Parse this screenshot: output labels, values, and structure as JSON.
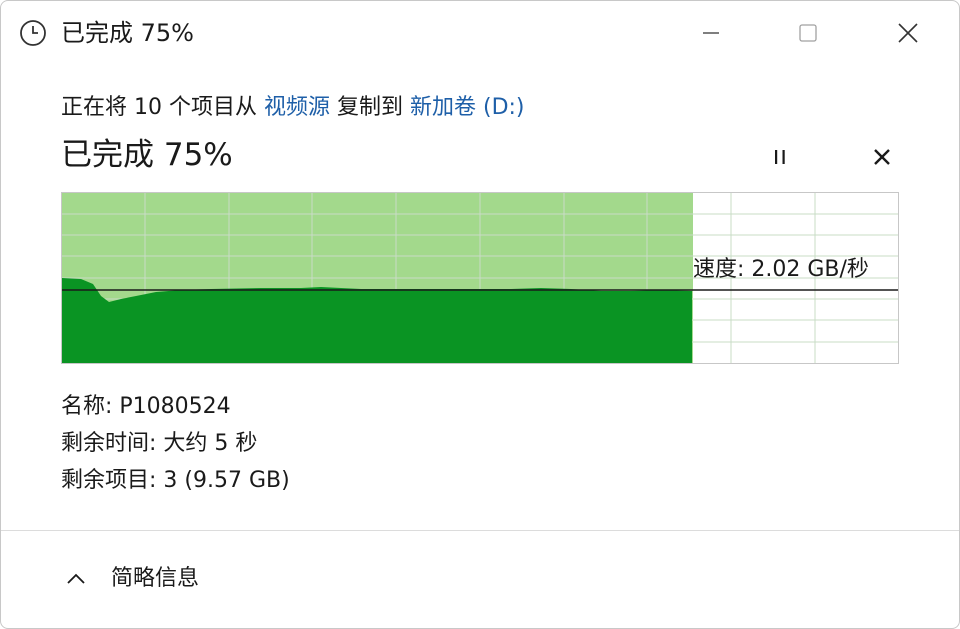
{
  "window": {
    "title": "已完成 75%",
    "minimize_icon": "minimize-icon",
    "maximize_icon": "maximize-icon",
    "close_icon": "close-icon"
  },
  "copy": {
    "prefix": "正在将 10 个项目从 ",
    "source": "视频源",
    "middle": " 复制到 ",
    "destination": "新加卷 (D:)",
    "progress_title": "已完成 75%",
    "progress_percent": 75,
    "speed_text": "速度: 2.02 GB/秒"
  },
  "details": {
    "name_label": "名称: ",
    "name_value": "P1080524",
    "time_label": "剩余时间: ",
    "time_value": "大约 5 秒",
    "items_label": "剩余项目: ",
    "items_value": "3 (9.57 GB)"
  },
  "footer": {
    "toggle_label": "简略信息",
    "toggle_icon": "chevron-up-icon"
  },
  "colors": {
    "fill_light": "#a3d98c",
    "fill_dark": "#0a9423",
    "grid": "#c9dcc6",
    "link": "#1e5fa8"
  }
}
